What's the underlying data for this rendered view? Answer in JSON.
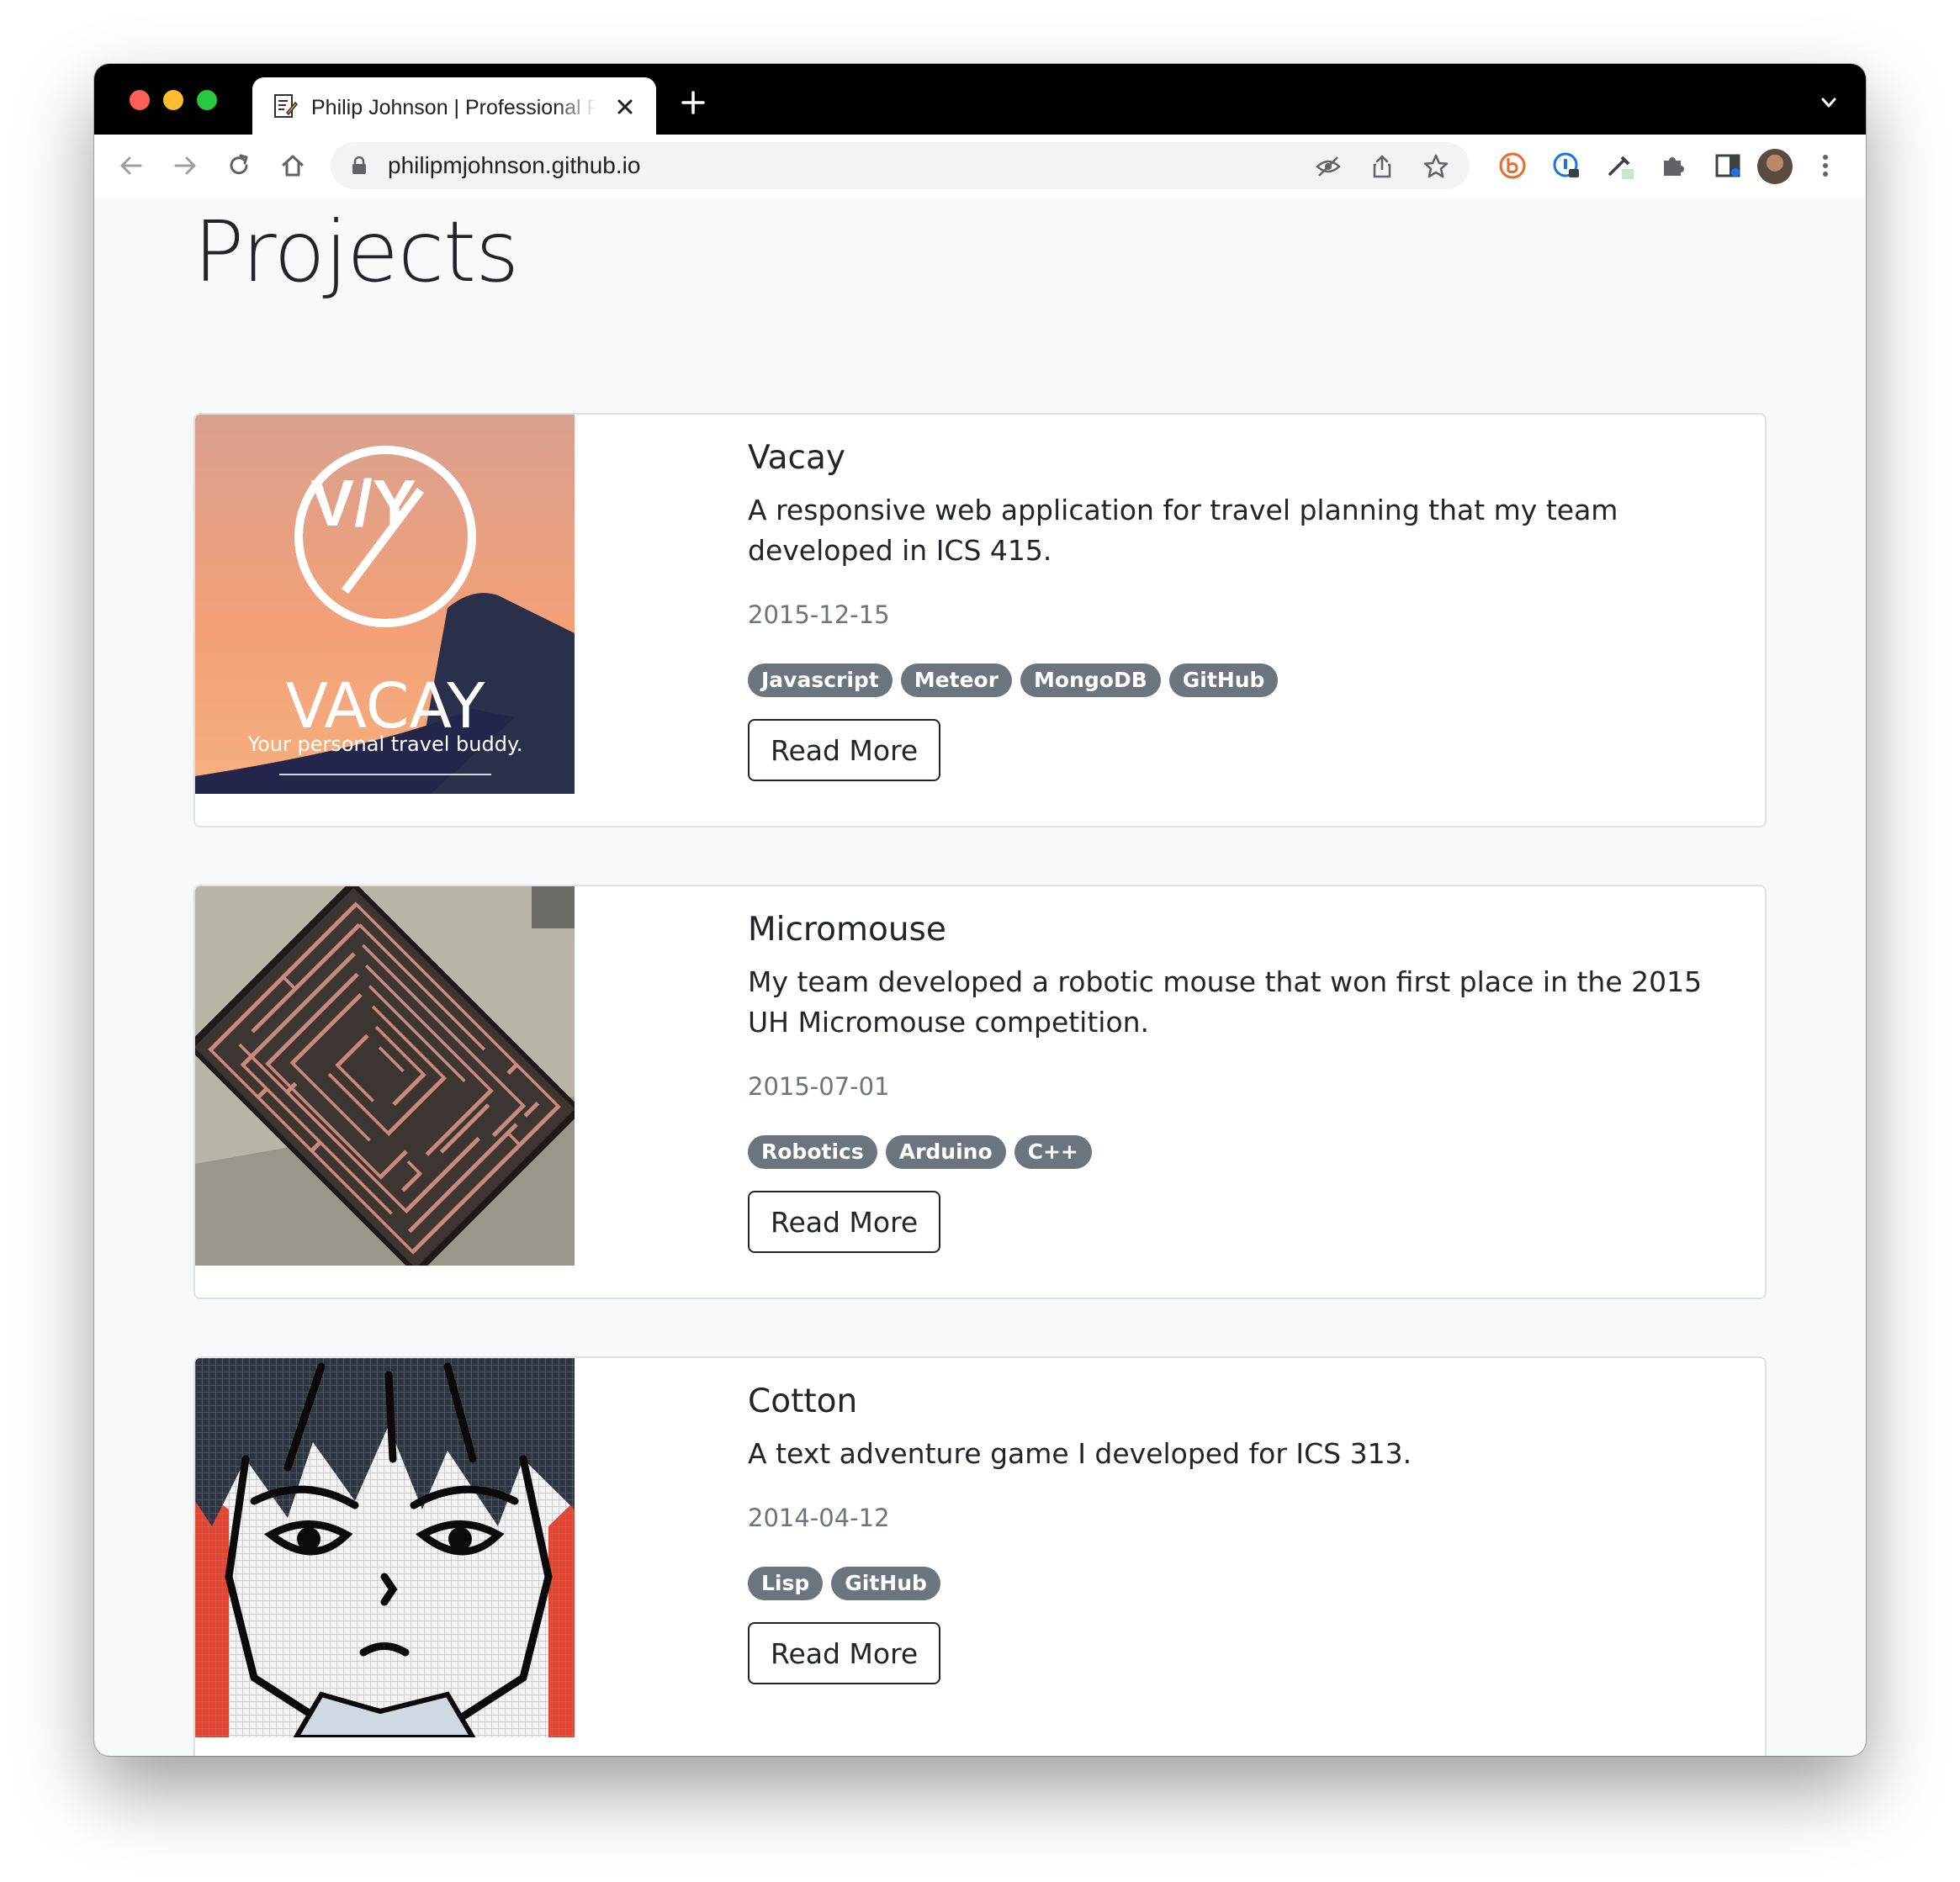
{
  "browser": {
    "tab_title": "Philip Johnson | Professional Portfolio",
    "url": "philipmjohnson.github.io"
  },
  "page": {
    "title": "Projects"
  },
  "projects": [
    {
      "title": "Vacay",
      "description": "A responsive web application for travel planning that my team developed in ICS 415.",
      "date": "2015-12-15",
      "tags": [
        "Javascript",
        "Meteor",
        "MongoDB",
        "GitHub"
      ],
      "button": "Read More",
      "image_text": {
        "logo": "V/Y",
        "name": "VACAY",
        "tagline": "Your personal travel buddy."
      }
    },
    {
      "title": "Micromouse",
      "description": "My team developed a robotic mouse that won first place in the 2015 UH Micromouse competition.",
      "date": "2015-07-01",
      "tags": [
        "Robotics",
        "Arduino",
        "C++"
      ],
      "button": "Read More"
    },
    {
      "title": "Cotton",
      "description": "A text adventure game I developed for ICS 313.",
      "date": "2014-04-12",
      "tags": [
        "Lisp",
        "GitHub"
      ],
      "button": "Read More"
    }
  ],
  "colors": {
    "badge": "#6c757d",
    "page_background": "#f8f9fa",
    "text": "#212529"
  }
}
